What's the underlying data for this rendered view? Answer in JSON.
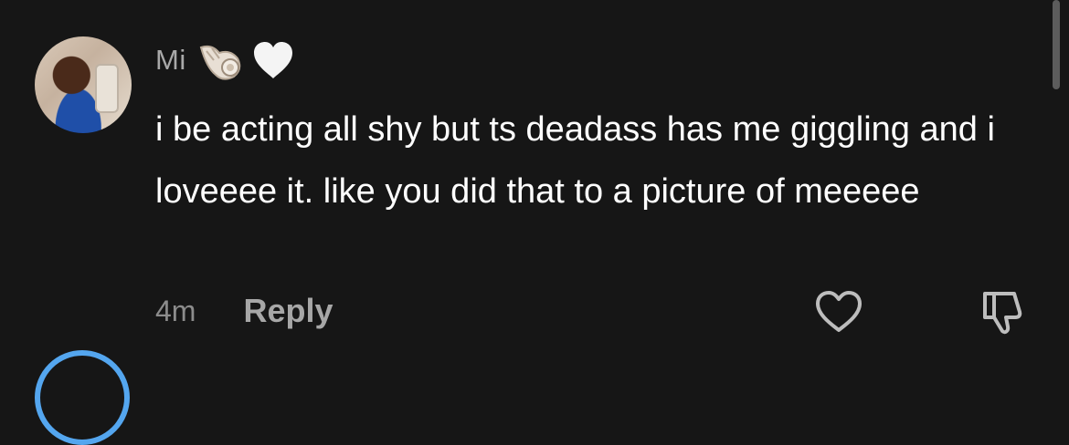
{
  "comment": {
    "username": "Mi",
    "text": "i be acting all shy but ts deadass has me giggling and i loveeee it. like you did that to a picture of meeeee",
    "timestamp": "4m",
    "reply_label": "Reply"
  },
  "icons": {
    "shell": "spiral-shell-icon",
    "heart": "white-heart-icon",
    "like": "heart-outline-icon",
    "dislike": "thumbs-down-icon",
    "more": "more-dots-icon"
  },
  "colors": {
    "background": "#161616",
    "text": "#ffffff",
    "muted": "#a9a9a9",
    "story_ring": "#54a6ef"
  }
}
